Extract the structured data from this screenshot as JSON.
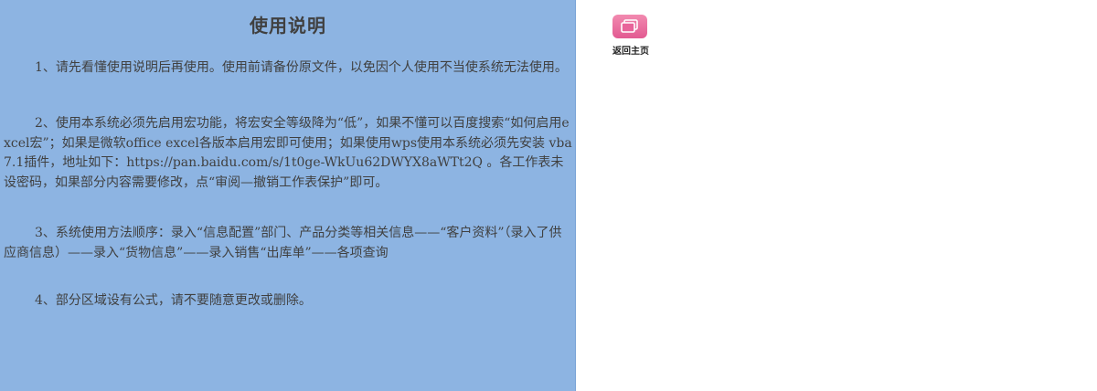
{
  "instructions": {
    "title": "使用说明",
    "items": [
      "1、请先看懂使用说明后再使用。使用前请备份原文件，以免因个人使用不当使系统无法使用。",
      "2、使用本系统必须先启用宏功能，将宏安全等级降为“低”，如果不懂可以百度搜索“如何启用excel宏”；如果是微软office excel各版本启用宏即可使用；如果使用wps使用本系统必须先安装 vba7.1插件，地址如下：https://pan.baidu.com/s/1t0ge-WkUu62DWYX8aWTt2Q 。各工作表未设密码，如果部分内容需要修改，点“审阅—撤销工作表保护”即可。",
      "3、系统使用方法顺序：录入“信息配置”部门、产品分类等相关信息——“客户资料”（录入了供应商信息）——录入“货物信息”——录入销售“出库单”——各项查询",
      "4、部分区域设有公式，请不要随意更改或删除。"
    ]
  },
  "home_button": {
    "label": "返回主页",
    "icon": "window-stack-icon",
    "color": "#e8649a"
  },
  "colors": {
    "panel_background": "#8db4e2",
    "text": "#404040"
  }
}
